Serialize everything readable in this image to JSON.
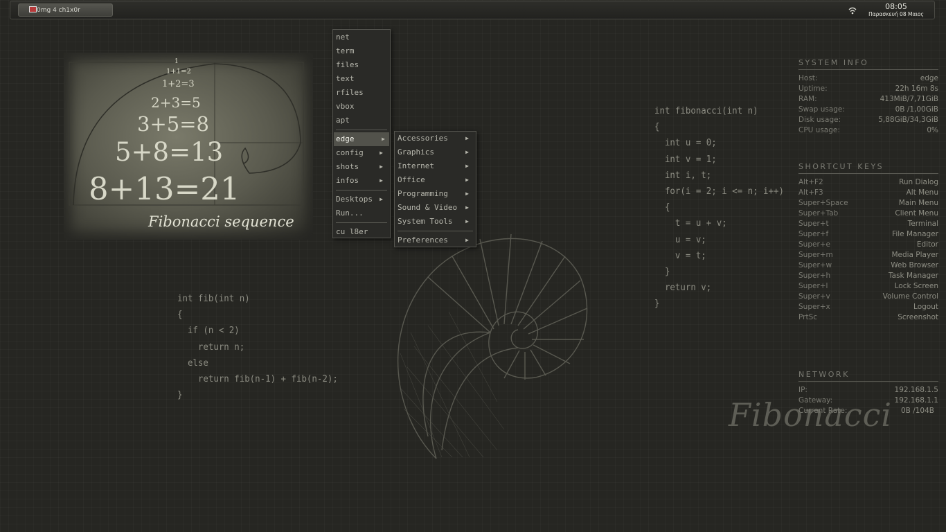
{
  "panel": {
    "task_label": "0mg 4 ch1x0r",
    "clock_time": "08:05",
    "clock_date": "Παρασκευή 08 Μαιος"
  },
  "main_menu": {
    "items_top": [
      "net",
      "term",
      "files",
      "text",
      "rfiles",
      "vbox",
      "apt"
    ],
    "items_sub": [
      "edge",
      "config",
      "shots",
      "infos"
    ],
    "items_bottom_sub": [
      "Desktops"
    ],
    "run": "Run...",
    "exit": "cu l8er",
    "selected": "edge"
  },
  "edge_menu": {
    "items": [
      "Accessories",
      "Graphics",
      "Internet",
      "Office",
      "Programming",
      "Sound & Video",
      "System Tools"
    ],
    "last": "Preferences"
  },
  "wallpaper": {
    "equations": [
      "1",
      "1+1=2",
      "1+2=3",
      "2+3=5",
      "3+5=8",
      "5+8=13",
      "8+13=21"
    ],
    "caption": "Fibonacci sequence",
    "script_title": "Fibonacci",
    "code_left": [
      "int fib(int n)",
      "{",
      "  if (n < 2)",
      "    return n;",
      "  else",
      "    return fib(n-1) + fib(n-2);",
      "}"
    ],
    "code_right": [
      "int fibonacci(int n)",
      "{",
      "  int u = 0;",
      "  int v = 1;",
      "  int i, t;",
      "  for(i = 2; i <= n; i++)",
      "  {",
      "    t = u + v;",
      "    u = v;",
      "    v = t;",
      "  }",
      "  return v;",
      "}"
    ]
  },
  "conky": {
    "system_info": {
      "title": "SYSTEM INFO",
      "rows": [
        {
          "k": "Host:",
          "v": "edge"
        },
        {
          "k": "Uptime:",
          "v": "22h 16m 8s"
        },
        {
          "k": "RAM:",
          "v": "413MiB/7,71GiB"
        },
        {
          "k": "Swap usage:",
          "v": "0B  /1,00GiB"
        },
        {
          "k": "Disk usage:",
          "v": "5,88GiB/34,3GiB"
        },
        {
          "k": "CPU usage:",
          "v": "0%"
        }
      ]
    },
    "shortcut_keys": {
      "title": "SHORTCUT KEYS",
      "rows": [
        {
          "k": "Alt+F2",
          "v": "Run Dialog"
        },
        {
          "k": "Alt+F3",
          "v": "Alt Menu"
        },
        {
          "k": "Super+Space",
          "v": "Main Menu"
        },
        {
          "k": "Super+Tab",
          "v": "Client Menu"
        },
        {
          "k": "Super+t",
          "v": "Terminal"
        },
        {
          "k": "Super+f",
          "v": "File Manager"
        },
        {
          "k": "Super+e",
          "v": "Editor"
        },
        {
          "k": "Super+m",
          "v": "Media Player"
        },
        {
          "k": "Super+w",
          "v": "Web Browser"
        },
        {
          "k": "Super+h",
          "v": "Task Manager"
        },
        {
          "k": "Super+l",
          "v": "Lock Screen"
        },
        {
          "k": "Super+v",
          "v": "Volume Control"
        },
        {
          "k": "Super+x",
          "v": "Logout"
        },
        {
          "k": "PrtSc",
          "v": "Screenshot"
        }
      ]
    },
    "network": {
      "title": "NETWORK",
      "rows": [
        {
          "k": "IP:",
          "v": "192.168.1.5"
        },
        {
          "k": "Gateway:",
          "v": "192.168.1.1"
        },
        {
          "k": "Current Rate:",
          "v": "0B  /104B"
        }
      ]
    }
  }
}
